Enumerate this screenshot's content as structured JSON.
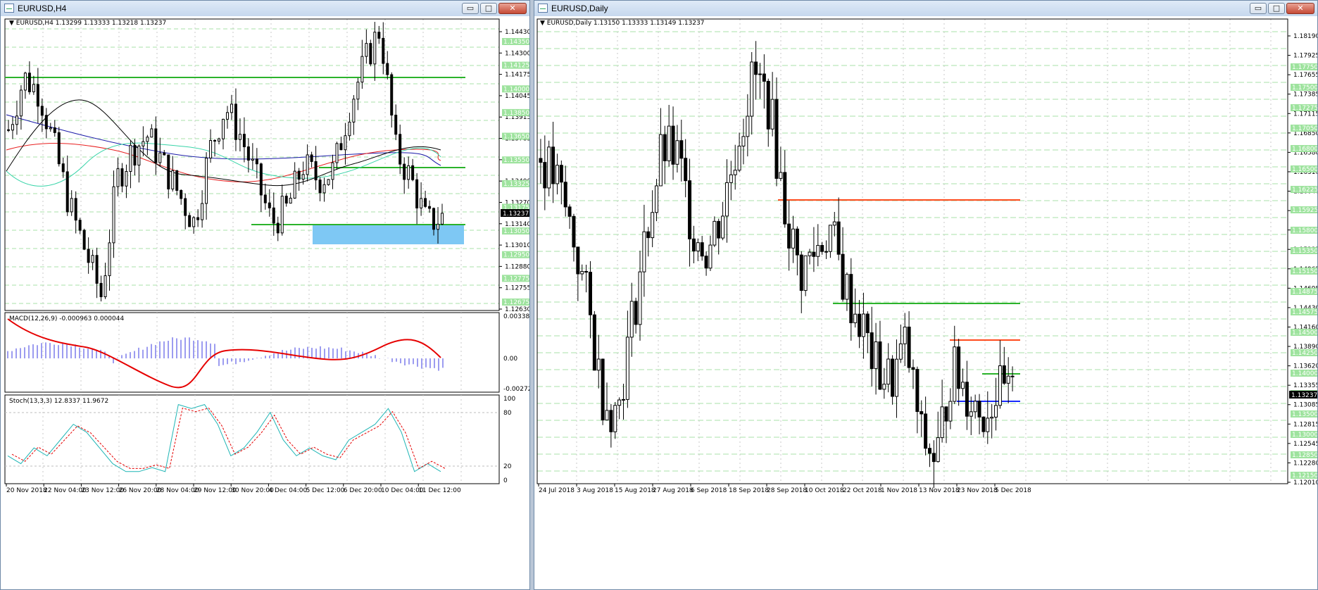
{
  "windows": [
    {
      "title": "EURUSD,H4",
      "info": "EURUSD,H4  1.13299 1.13333 1.13218 1.13237",
      "current_price": "1.13237",
      "price_axis": [
        "1.14430",
        "1.14300",
        "1.14175",
        "1.14045",
        "1.13915",
        "1.13785",
        "1.13525",
        "1.13400",
        "1.13270",
        "1.13140",
        "1.13010",
        "1.12880",
        "1.12755",
        "1.12630"
      ],
      "level_labels": [
        "1.14350",
        "1.14125",
        "1.14000",
        "1.13850",
        "1.13650",
        "1.13550",
        "1.13325",
        "1.13175",
        "1.13050",
        "1.12950",
        "1.12775",
        "1.12675"
      ],
      "time_axis": [
        "20 Nov 2018",
        "22 Nov 04:00",
        "23 Nov 12:00",
        "26 Nov 20:00",
        "28 Nov 04:00",
        "29 Nov 12:00",
        "30 Nov 20:00",
        "4 Dec 04:00",
        "5 Dec 12:00",
        "6 Dec 20:00",
        "10 Dec 04:00",
        "11 Dec 12:00"
      ],
      "macd": {
        "label": "MACD(12,26,9) -0.000963 0.000044",
        "axis": [
          "0.00338",
          "0.00",
          "-0.002724"
        ]
      },
      "stoch": {
        "label": "Stoch(13,3,3) 12.8337 11.9672",
        "axis": [
          "100",
          "80",
          "20",
          "0"
        ]
      }
    },
    {
      "title": "EURUSD,Daily",
      "info": "EURUSD,Daily  1.13150 1.13333 1.13149 1.13237",
      "current_price": "1.13237",
      "price_axis": [
        "1.18190",
        "1.17925",
        "1.17655",
        "1.17385",
        "1.17115",
        "1.16850",
        "1.16580",
        "1.16310",
        "1.16040",
        "1.15770",
        "1.15505",
        "1.15235",
        "1.14965",
        "1.14695",
        "1.14430",
        "1.14160",
        "1.13890",
        "1.13620",
        "1.13355",
        "1.13085",
        "1.12815",
        "1.12545",
        "1.12280",
        "1.12010"
      ],
      "level_labels": [
        "1.17750",
        "1.17500",
        "1.17275",
        "1.17050",
        "1.16800",
        "1.16500",
        "1.16225",
        "1.15925",
        "1.15800",
        "1.15350",
        "1.15150",
        "1.14875",
        "1.14575",
        "1.14500",
        "1.14250",
        "1.14000",
        "1.13850",
        "1.13500",
        "1.13000",
        "1.12850",
        "1.12150"
      ],
      "time_axis": [
        "24 Jul 2018",
        "3 Aug 2018",
        "15 Aug 2018",
        "27 Aug 2018",
        "6 Sep 2018",
        "18 Sep 2018",
        "28 Sep 2018",
        "10 Oct 2018",
        "22 Oct 2018",
        "1 Nov 2018",
        "13 Nov 2018",
        "23 Nov 2018",
        "5 Dec 2018"
      ]
    }
  ],
  "controls": {
    "minimize": "▭",
    "maximize": "□",
    "close": "✕"
  },
  "colors": {
    "green_line": "#2bb32b",
    "red_line": "#ff4a1c",
    "blue_line": "#1a2bff",
    "zone": "#7ec8f4",
    "level_box": "#9ee39e"
  }
}
